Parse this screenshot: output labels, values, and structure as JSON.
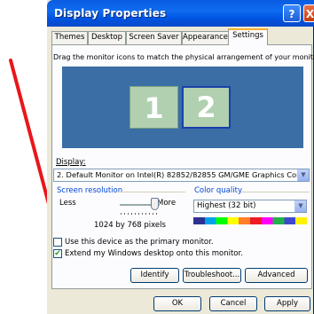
{
  "window": {
    "title": "Display Properties",
    "help_label": "?",
    "close_label": "X"
  },
  "tabs": [
    {
      "label": "Themes"
    },
    {
      "label": "Desktop"
    },
    {
      "label": "Screen Saver"
    },
    {
      "label": "Appearance"
    },
    {
      "label": "Settings"
    }
  ],
  "settings": {
    "description": "Drag the monitor icons to match the physical arrangement of your monitors.",
    "monitors": [
      "1",
      "2"
    ],
    "display_label": "Display:",
    "display_value": "2. Default Monitor on Intel(R) 82852/82855 GM/GME Graphics Control",
    "resolution": {
      "group_label": "Screen resolution",
      "less": "Less",
      "more": "More",
      "value": "1024 by 768 pixels"
    },
    "color": {
      "group_label": "Color quality",
      "value": "Highest (32 bit)"
    },
    "primary_checkbox": {
      "label": "Use this device as the primary monitor.",
      "checked": false
    },
    "extend_checkbox": {
      "label": "Extend my Windows desktop onto this monitor.",
      "checked": true
    },
    "buttons": {
      "identify": "Identify",
      "troubleshoot": "Troubleshoot...",
      "advanced": "Advanced"
    }
  },
  "footer": {
    "ok": "OK",
    "cancel": "Cancel",
    "apply": "Apply"
  },
  "annotation": {
    "arrow_color": "#e8161b"
  }
}
